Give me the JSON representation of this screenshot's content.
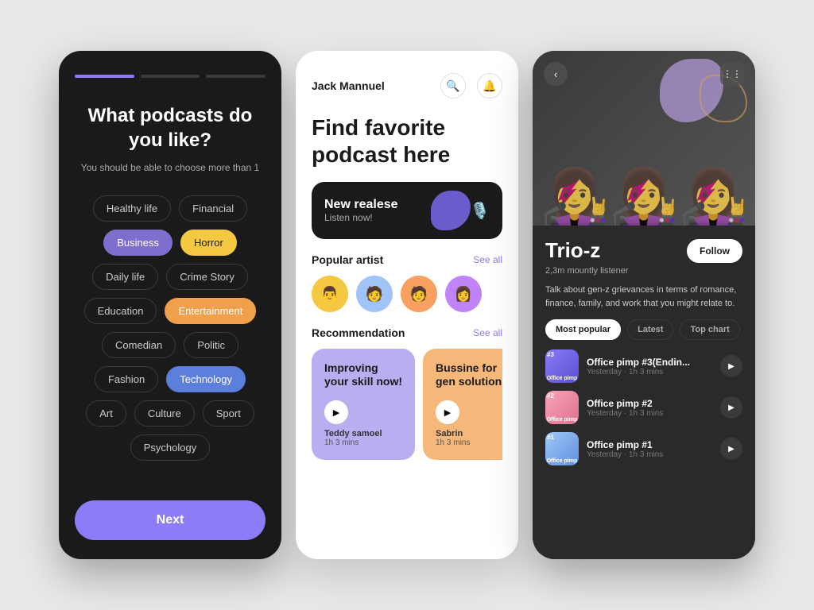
{
  "screen1": {
    "progress": [
      {
        "id": "p1",
        "state": "active"
      },
      {
        "id": "p2",
        "state": "inactive"
      },
      {
        "id": "p3",
        "state": "inactive"
      }
    ],
    "title": "What podcasts do you like?",
    "subtitle": "You should be able to choose more than 1",
    "tags": [
      {
        "label": "Healthy life",
        "style": "default"
      },
      {
        "label": "Financial",
        "style": "default"
      },
      {
        "label": "Business",
        "style": "selected-purple"
      },
      {
        "label": "Horror",
        "style": "selected-yellow"
      },
      {
        "label": "Daily life",
        "style": "default"
      },
      {
        "label": "Crime Story",
        "style": "default"
      },
      {
        "label": "Education",
        "style": "default"
      },
      {
        "label": "Entertainment",
        "style": "selected-orange"
      },
      {
        "label": "Comedian",
        "style": "default"
      },
      {
        "label": "Politic",
        "style": "default"
      },
      {
        "label": "Fashion",
        "style": "default"
      },
      {
        "label": "Technology",
        "style": "selected-blue"
      },
      {
        "label": "Art",
        "style": "default"
      },
      {
        "label": "Culture",
        "style": "default"
      },
      {
        "label": "Sport",
        "style": "default"
      },
      {
        "label": "Psychology",
        "style": "default"
      }
    ],
    "next_button": "Next"
  },
  "screen2": {
    "username": "Jack Mannuel",
    "search_icon": "🔍",
    "bell_icon": "🔔",
    "title": "Find favorite podcast here",
    "banner": {
      "label": "New realese",
      "sub_label": "Listen now!",
      "icon": "🎙️"
    },
    "popular_section": "Popular artist",
    "see_all_1": "See all",
    "artists": [
      {
        "color": "#f5c842",
        "icon": "👨"
      },
      {
        "color": "#a0c4f8",
        "icon": "🧑"
      },
      {
        "color": "#f8a060",
        "icon": "🧑"
      },
      {
        "color": "#c084f8",
        "icon": "👩"
      }
    ],
    "recommendation_section": "Recommendation",
    "see_all_2": "See all",
    "rec_cards": [
      {
        "style": "purple",
        "title": "Improving your skill now!",
        "author": "Teddy samoel",
        "duration": "1h 3 mins"
      },
      {
        "style": "orange",
        "title": "Bussine for gen solution",
        "author": "Sabrin",
        "duration": "1h 3 mins"
      }
    ]
  },
  "screen3": {
    "back_label": "‹",
    "grid_label": "⋮⋮",
    "artist_name": "Trio-z",
    "follow_label": "Follow",
    "listeners": "2,3m mountly listener",
    "description": "Talk about gen-z grievances in terms of romance, finance, family, and work that you might relate to.",
    "tabs": [
      {
        "label": "Most popular",
        "active": true
      },
      {
        "label": "Latest",
        "active": false
      },
      {
        "label": "Top chart",
        "active": false
      }
    ],
    "podcasts": [
      {
        "thumb_class": "t1",
        "badge": "#3",
        "label": "Office pimp",
        "title": "Office pimp #3(Endin...",
        "meta": "Yesterday · 1h 3 mins"
      },
      {
        "thumb_class": "t2",
        "badge": "#2",
        "label": "Office pimp",
        "title": "Office pimp #2",
        "meta": "Yesterday · 1h 3 mins"
      },
      {
        "thumb_class": "t3",
        "badge": "#1",
        "label": "Office pimp",
        "title": "Office pimp #1",
        "meta": "Yesterday · 1h 3 mins"
      }
    ]
  }
}
